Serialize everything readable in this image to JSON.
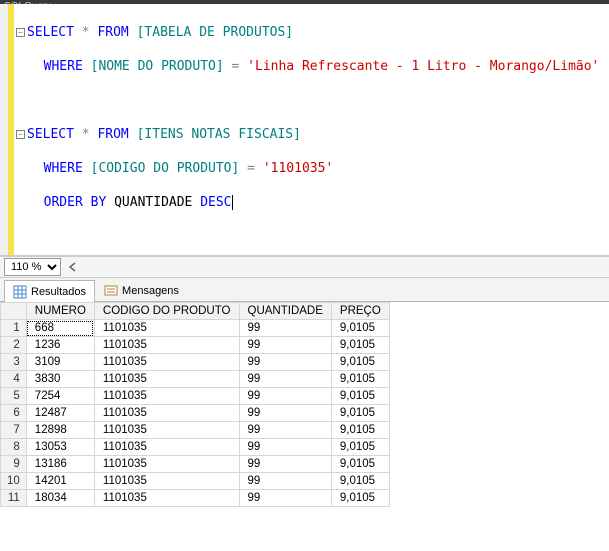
{
  "title_bar": "SQLQuery...",
  "zoom": {
    "level": "110 %"
  },
  "code": {
    "line1": {
      "select": "SELECT",
      "star": " * ",
      "from": "FROM",
      "table": " [TABELA DE PRODUTOS]"
    },
    "line2": {
      "indent": "  ",
      "where": "WHERE",
      "col": " [NOME DO PRODUTO] ",
      "eq": "=",
      "str": " 'Linha Refrescante - 1 Litro - Morango/Limão'"
    },
    "line4": {
      "select": "SELECT",
      "star": " * ",
      "from": "FROM",
      "table": " [ITENS NOTAS FISCAIS]"
    },
    "line5": {
      "indent": "  ",
      "where": "WHERE",
      "col": " [CODIGO DO PRODUTO] ",
      "eq": "=",
      "str": " '1101035'"
    },
    "line6": {
      "indent": "  ",
      "orderby": "ORDER BY",
      "col": " QUANTIDADE ",
      "desc": "DESC"
    }
  },
  "tabs": {
    "results": "Resultados",
    "messages": "Mensagens"
  },
  "grid": {
    "columns": [
      "NUMERO",
      "CODIGO DO PRODUTO",
      "QUANTIDADE",
      "PREÇO"
    ],
    "rows": [
      {
        "n": "1",
        "numero": "668",
        "codigo": "1101035",
        "qtd": "99",
        "preco": "9,0105"
      },
      {
        "n": "2",
        "numero": "1236",
        "codigo": "1101035",
        "qtd": "99",
        "preco": "9,0105"
      },
      {
        "n": "3",
        "numero": "3109",
        "codigo": "1101035",
        "qtd": "99",
        "preco": "9,0105"
      },
      {
        "n": "4",
        "numero": "3830",
        "codigo": "1101035",
        "qtd": "99",
        "preco": "9,0105"
      },
      {
        "n": "5",
        "numero": "7254",
        "codigo": "1101035",
        "qtd": "99",
        "preco": "9,0105"
      },
      {
        "n": "6",
        "numero": "12487",
        "codigo": "1101035",
        "qtd": "99",
        "preco": "9,0105"
      },
      {
        "n": "7",
        "numero": "12898",
        "codigo": "1101035",
        "qtd": "99",
        "preco": "9,0105"
      },
      {
        "n": "8",
        "numero": "13053",
        "codigo": "1101035",
        "qtd": "99",
        "preco": "9,0105"
      },
      {
        "n": "9",
        "numero": "13186",
        "codigo": "1101035",
        "qtd": "99",
        "preco": "9,0105"
      },
      {
        "n": "10",
        "numero": "14201",
        "codigo": "1101035",
        "qtd": "99",
        "preco": "9,0105"
      },
      {
        "n": "11",
        "numero": "18034",
        "codigo": "1101035",
        "qtd": "99",
        "preco": "9,0105"
      }
    ]
  }
}
